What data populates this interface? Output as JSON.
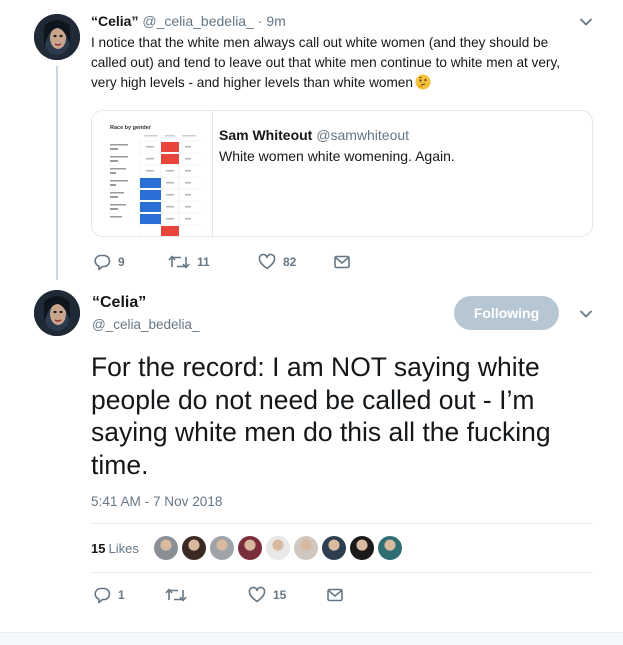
{
  "tweet1": {
    "display_name": "“Celia”",
    "handle": "@_celia_bedelia_",
    "separator": "·",
    "time": "9m",
    "text": "I notice that the white men always call out white women (and they should be called out) and tend to leave out that white men continue to white men at very, very high levels - and higher levels than white women",
    "emoji": "thinking-face-emoji",
    "quoted": {
      "display_name": "Sam Whiteout",
      "handle": "@samwhiteout",
      "text": "White women white womening. Again.",
      "image": {
        "title": "Race by gender",
        "description": "chart thumbnail"
      }
    },
    "actions": {
      "replies": "9",
      "retweets": "11",
      "likes": "82"
    }
  },
  "tweet2": {
    "display_name": "“Celia”",
    "handle": "@_celia_bedelia_",
    "follow_button": "Following",
    "text": "For the record: I am NOT saying white people do not need be called out - I’m saying white men do this all the fucking time.",
    "timestamp": "5:41 AM - 7 Nov 2018",
    "likes_count": "15",
    "likes_label": "Likes",
    "likers": [
      "#8a8f96",
      "#3b2a24",
      "#9da3a8",
      "#7a2d3a",
      "#e8e8e8",
      "#cfc7c0",
      "#2c3e50",
      "#1a1a1a",
      "#2f6f73"
    ],
    "actions": {
      "replies": "1",
      "retweets": "",
      "likes": "15"
    }
  },
  "colors": {
    "text": "#14171a",
    "muted": "#657786",
    "border": "#e1e8ed",
    "following_button": "#b6c6d3"
  }
}
